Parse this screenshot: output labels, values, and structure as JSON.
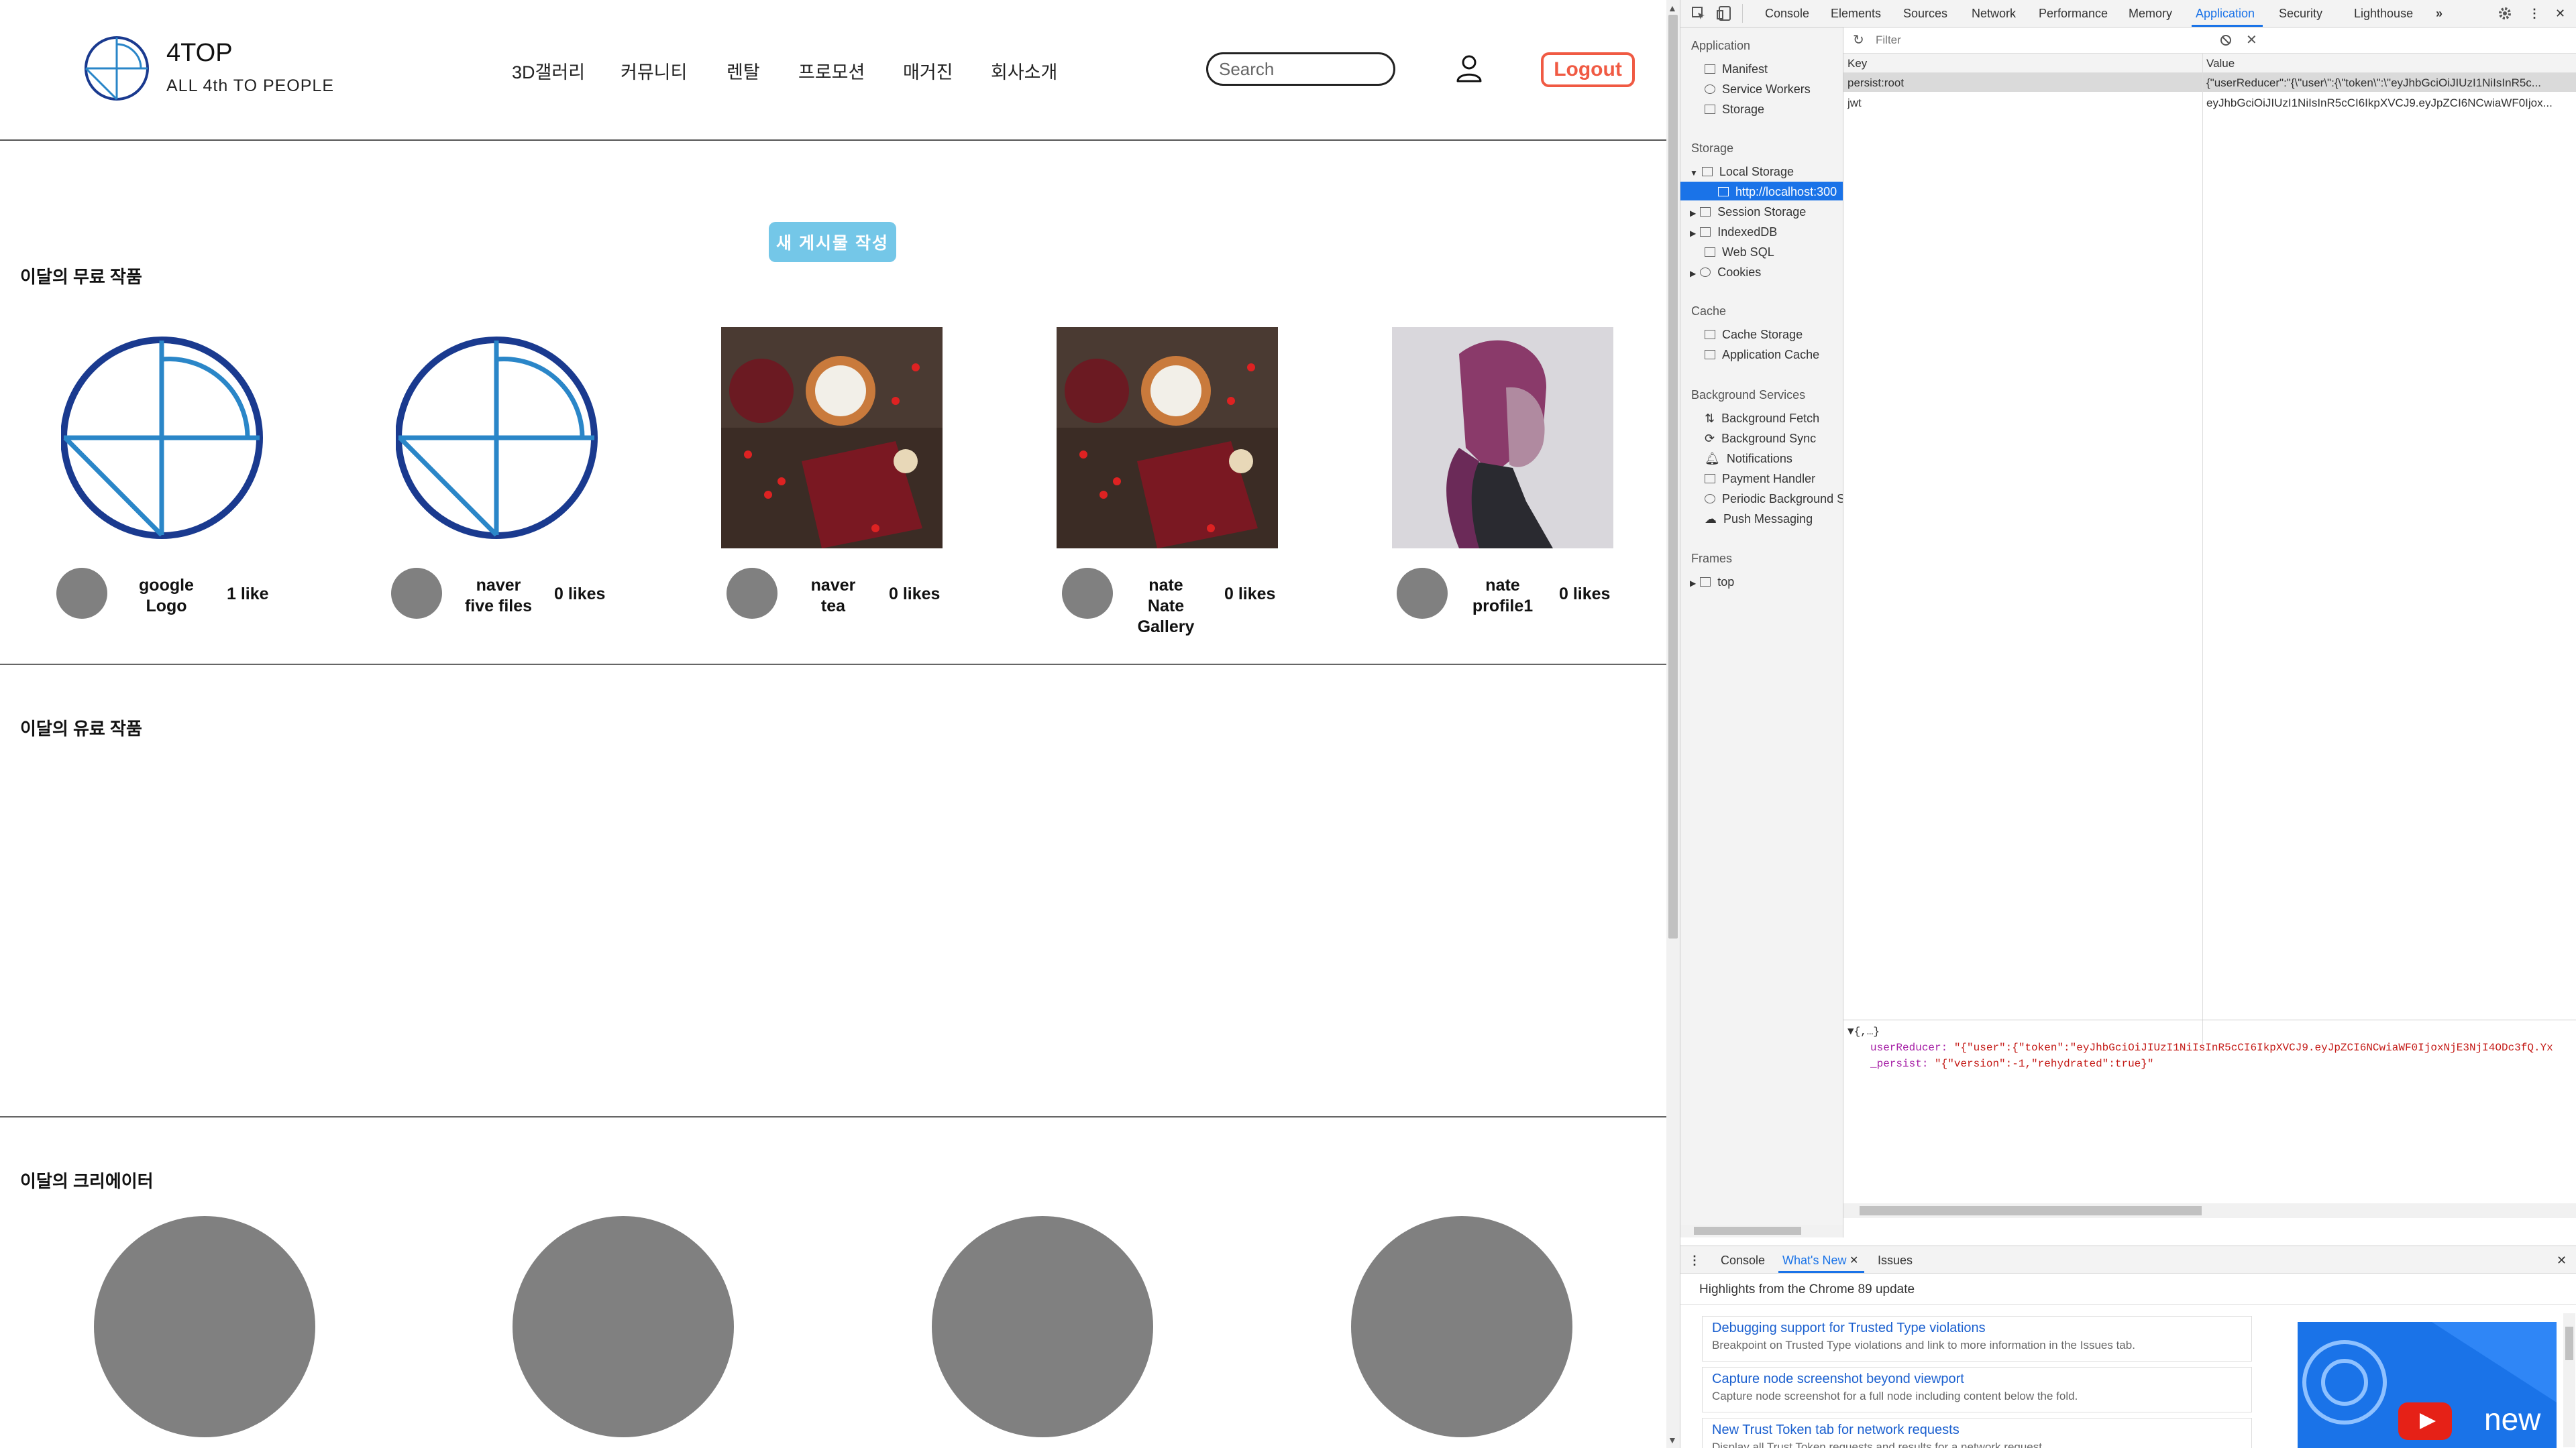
{
  "site": {
    "logo": {
      "title": "4TOP",
      "subtitle": "ALL 4th TO PEOPLE"
    },
    "nav": [
      "3D갤러리",
      "커뮤니티",
      "렌탈",
      "프로모션",
      "매거진",
      "회사소개"
    ],
    "search": {
      "placeholder": "Search"
    },
    "logout_label": "Logout",
    "new_post_label": "새 게시물 작성",
    "sections": {
      "free": "이달의 무료 작품",
      "paid": "이달의 유료 작품",
      "creators": "이달의 크리에이터"
    },
    "cards": [
      {
        "line1": "google",
        "line2": "Logo",
        "likes": "1 like",
        "image": "logo"
      },
      {
        "line1": "naver",
        "line2": "five files",
        "likes": "0 likes",
        "image": "logo"
      },
      {
        "line1": "naver",
        "line2": "tea",
        "likes": "0 likes",
        "image": "coffee-photo"
      },
      {
        "line1": "nate",
        "line2": "Nate Gallery",
        "likes": "0 likes",
        "image": "coffee-photo"
      },
      {
        "line1": "nate",
        "line2": "profile1",
        "likes": "0 likes",
        "image": "portrait-photo"
      }
    ],
    "creator_count": 4,
    "colors": {
      "logout": "#f05a43",
      "new_post": "#74c7e8",
      "logo_blue": "#1a3a8f",
      "avatar_gray": "#808080"
    }
  },
  "devtools": {
    "tabs": [
      "Console",
      "Elements",
      "Sources",
      "Network",
      "Performance",
      "Memory",
      "Application",
      "Security",
      "Lighthouse"
    ],
    "active_tab": "Application",
    "sidebar": {
      "application": {
        "head": "Application",
        "items": [
          "Manifest",
          "Service Workers",
          "Storage"
        ]
      },
      "storage": {
        "head": "Storage",
        "local": "Local Storage",
        "local_child": "http://localhost:300",
        "items": [
          "Session Storage",
          "IndexedDB",
          "Web SQL",
          "Cookies"
        ]
      },
      "cache": {
        "head": "Cache",
        "items": [
          "Cache Storage",
          "Application Cache"
        ]
      },
      "background": {
        "head": "Background Services",
        "items": [
          "Background Fetch",
          "Background Sync",
          "Notifications",
          "Payment Handler",
          "Periodic Background S",
          "Push Messaging"
        ]
      },
      "frames": {
        "head": "Frames",
        "items": [
          "top"
        ]
      }
    },
    "filter_placeholder": "Filter",
    "table": {
      "key_header": "Key",
      "value_header": "Value",
      "rows": [
        {
          "key": "persist:root",
          "value": "{\"userReducer\":\"{\\\"user\\\":{\\\"token\\\":\\\"eyJhbGciOiJIUzI1NiIsInR5c..."
        },
        {
          "key": "jwt",
          "value": "eyJhbGciOiJIUzI1NiIsInR5cCI6IkpXVCJ9.eyJpZCI6NCwiaWF0Ijox..."
        }
      ]
    },
    "preview": {
      "root": "{,…}",
      "line1_key": "userReducer:",
      "line1_val": "\"{\"user\":{\"token\":\"eyJhbGciOiJIUzI1NiIsInR5cCI6IkpXVCJ9.eyJpZCI6NCwiaWF0IjoxNjE3NjI4ODc3fQ.Yx",
      "line2_key": "_persist:",
      "line2_val": "\"{\"version\":-1,\"rehydrated\":true}\""
    },
    "drawer": {
      "tabs": [
        "Console",
        "What's New",
        "Issues"
      ],
      "active": "What's New",
      "headline": "Highlights from the Chrome 89 update",
      "news": [
        {
          "title": "Debugging support for Trusted Type violations",
          "desc": "Breakpoint on Trusted Type violations and link to more information in the Issues tab."
        },
        {
          "title": "Capture node screenshot beyond viewport",
          "desc": "Capture node screenshot for a full node including content below the fold."
        },
        {
          "title": "New Trust Token tab for network requests",
          "desc": "Display all Trust Token requests and results for a network request."
        }
      ],
      "promo_text": "new"
    }
  }
}
